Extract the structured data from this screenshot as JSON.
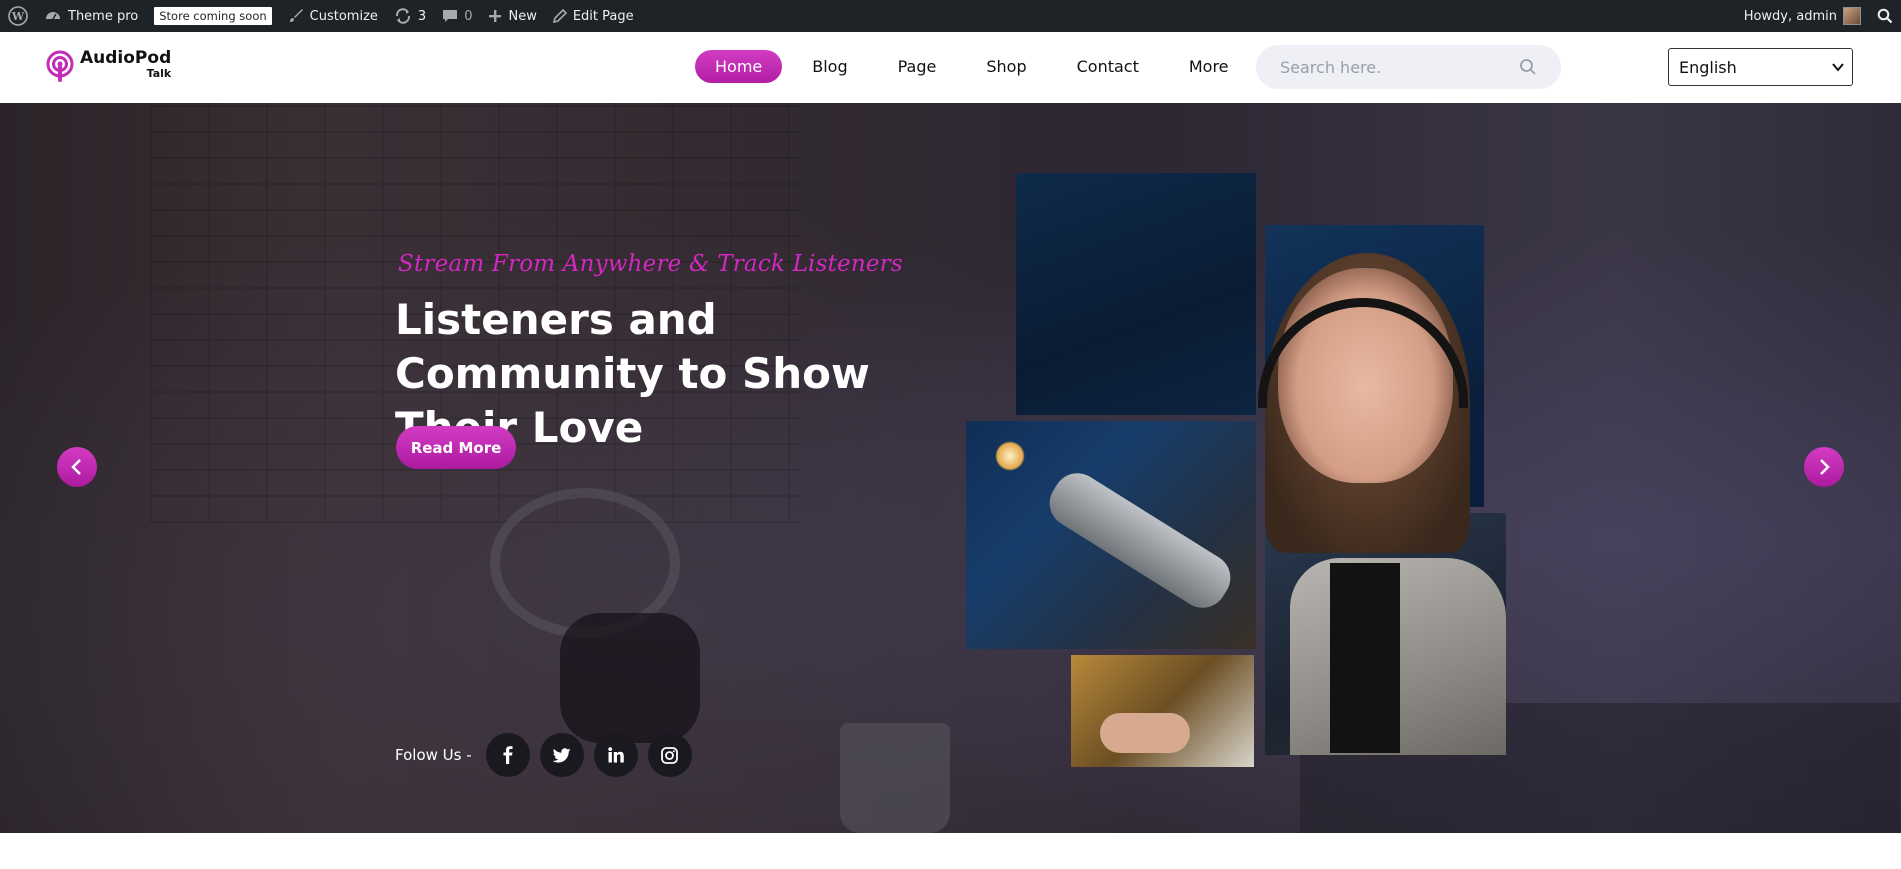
{
  "adminbar": {
    "site_name": "Theme pro",
    "store_badge": "Store coming soon",
    "customize": "Customize",
    "updates_count": "3",
    "comments_count": "0",
    "new": "New",
    "edit_page": "Edit Page",
    "howdy": "Howdy, admin"
  },
  "header": {
    "logo_title": "AudioPod",
    "logo_sub": "Talk",
    "nav": [
      "Home",
      "Blog",
      "Page",
      "Shop",
      "Contact",
      "More"
    ],
    "search_placeholder": "Search here.",
    "language": "English"
  },
  "hero": {
    "kicker": "Stream From Anywhere & Track Listeners",
    "headline": "Listeners and Community to Show Their Love",
    "button": "Read More",
    "follow_label": "Folow Us -",
    "socials": [
      "facebook-icon",
      "twitter-icon",
      "linkedin-icon",
      "instagram-icon"
    ]
  },
  "colors": {
    "accent": "#c22cb6",
    "adminbar": "#1d2327"
  }
}
